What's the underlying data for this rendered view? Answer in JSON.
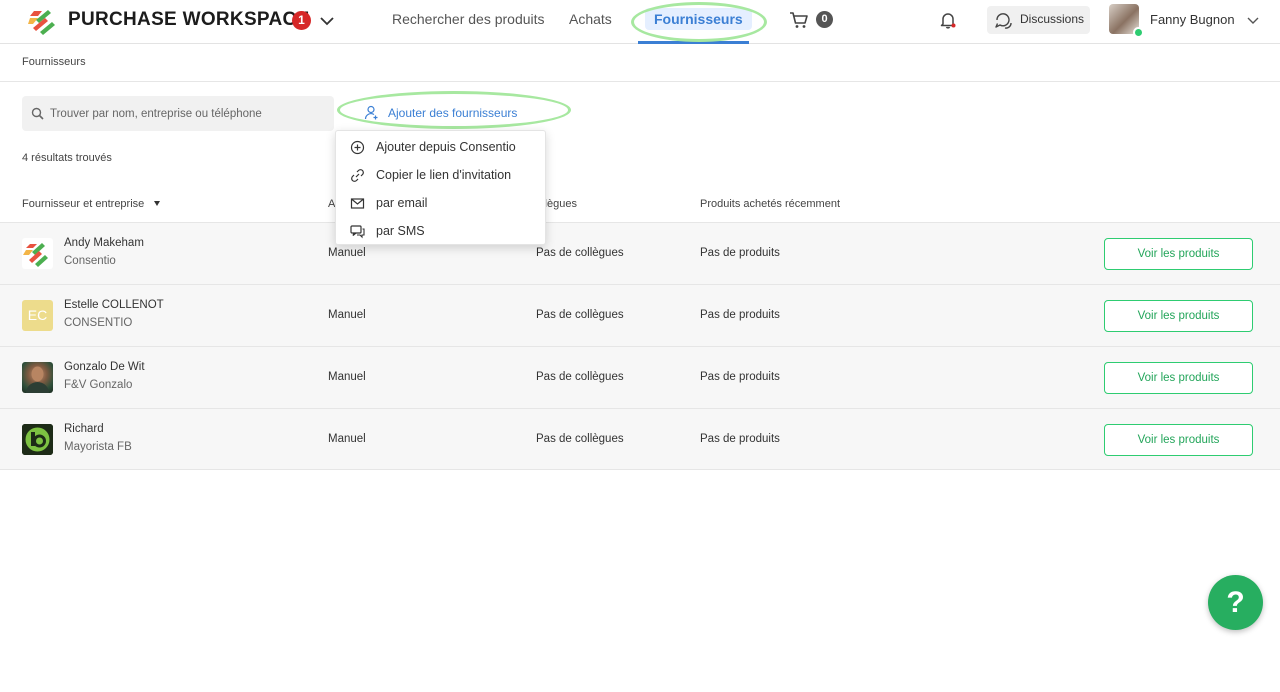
{
  "header": {
    "app_title": "PURCHASE WORKSPACE",
    "title_badge": "1",
    "nav": {
      "search_products": "Rechercher des produits",
      "purchases": "Achats",
      "suppliers": "Fournisseurs"
    },
    "cart_count": "0",
    "discussions_label": "Discussions",
    "user_name": "Fanny Bugnon",
    "icons": [
      "logo-icon",
      "chevron-down-icon",
      "cart-icon",
      "bell-icon",
      "chat-icon",
      "avatar",
      "chevron-down-icon"
    ],
    "colors": {
      "accent_blue": "#3b7fd4",
      "badge_red": "#d62828",
      "highlight_green": "#a7e8a0"
    }
  },
  "breadcrumb": "Fournisseurs",
  "search": {
    "placeholder": "Trouver par nom, entreprise ou téléphone"
  },
  "add_suppliers_label": "Ajouter des fournisseurs",
  "results_count": "4 résultats trouvés",
  "dropdown": {
    "items": [
      {
        "label": "Ajouter depuis Consentio",
        "icon": "plus-circle-icon"
      },
      {
        "label": "Copier le lien d'invitation",
        "icon": "link-icon"
      },
      {
        "label": "par email",
        "icon": "email-icon"
      },
      {
        "label": "par SMS",
        "icon": "sms-icon"
      }
    ]
  },
  "table": {
    "headers": {
      "supplier": "Fournisseur et entreprise",
      "type": "A",
      "colleagues": "ollègues",
      "products": "Produits achetés récemment"
    },
    "rows": [
      {
        "name": "Andy Makeham",
        "company": "Consentio",
        "type": "Manuel",
        "colleagues": "Pas de collègues",
        "products": "Pas de produits",
        "button": "Voir les produits",
        "avatar": "consentio-logo"
      },
      {
        "name": "Estelle COLLENOT",
        "company": "CONSENTIO",
        "type": "Manuel",
        "colleagues": "Pas de collègues",
        "products": "Pas de produits",
        "button": "Voir les produits",
        "avatar_initials": "EC"
      },
      {
        "name": "Gonzalo De Wit",
        "company": "F&V Gonzalo",
        "type": "Manuel",
        "colleagues": "Pas de collègues",
        "products": "Pas de produits",
        "button": "Voir les produits",
        "avatar": "photo"
      },
      {
        "name": "Richard",
        "company": "Mayorista FB",
        "type": "Manuel",
        "colleagues": "Pas de collègues",
        "products": "Pas de produits",
        "button": "Voir les produits",
        "avatar": "fb-logo"
      }
    ]
  },
  "help_label": "?"
}
